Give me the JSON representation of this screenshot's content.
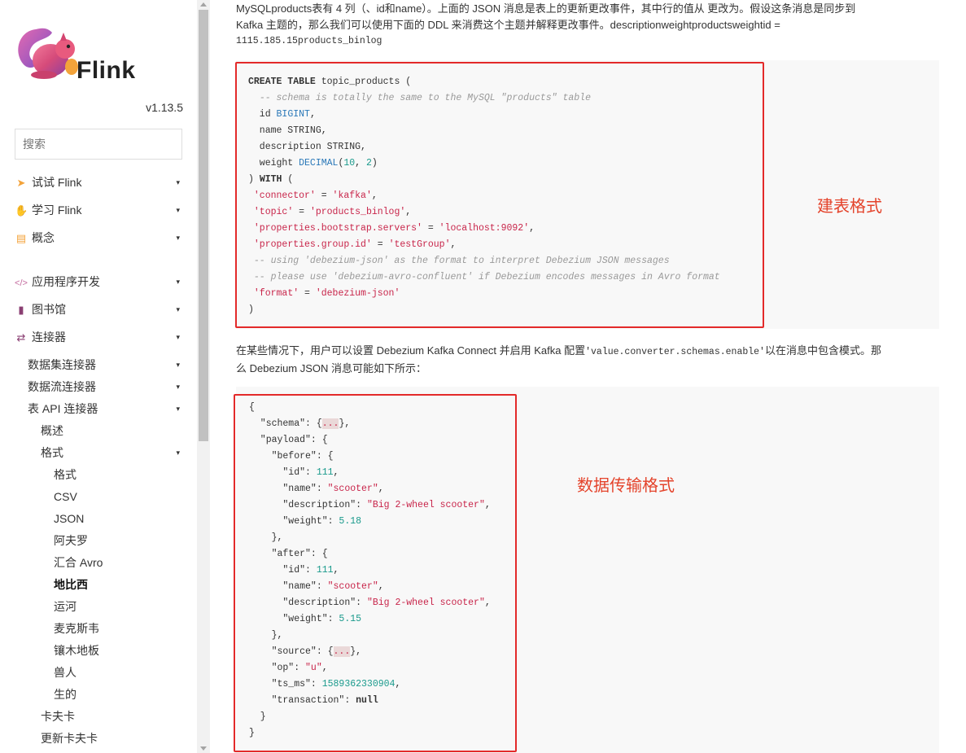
{
  "sidebar": {
    "logo_text": "Flink",
    "version": "v1.13.5",
    "search_placeholder": "搜索",
    "nav": [
      {
        "label": "试试 Flink",
        "icon": "rocket-icon"
      },
      {
        "label": "学习 Flink",
        "icon": "hand-icon"
      },
      {
        "label": "概念",
        "icon": "book-open-icon"
      },
      {
        "label": "应用程序开发",
        "icon": "code-icon"
      },
      {
        "label": "图书馆",
        "icon": "book-icon"
      },
      {
        "label": "连接器",
        "icon": "shuffle-icon"
      }
    ],
    "connectors": {
      "dataset": "数据集连接器",
      "datastream": "数据流连接器",
      "table_api": "表 API 连接器",
      "overview": "概述",
      "formats": "格式",
      "formats_items": [
        "格式",
        "CSV",
        "JSON",
        "阿夫罗",
        "汇合 Avro",
        "地比西",
        "运河",
        "麦克斯韦",
        "镶木地板",
        "兽人",
        "生的"
      ],
      "kafka": "卡夫卡",
      "upsert_kafka": "更新卡夫卡"
    },
    "caret": "▾"
  },
  "content": {
    "intro_line1": "MySQLproducts表有 4 列（、id和name）。上面的 JSON 消息是表上的更新更改事件，其中行的值从 更改为。假设这条消息是同步到",
    "intro_line2": "Kafka 主题的，那么我们可以使用下面的 DDL 来消费这个主题并解释更改事件。descriptionweightproductsweightid =",
    "intro_line3": "1115.185.15products_binlog",
    "para2_line1_a": "在某些情况下，用户可以设置 Debezium Kafka Connect 并启用 Kafka 配置",
    "para2_line1_code": "'value.converter.schemas.enable'",
    "para2_line1_b": "以在消息中包含模式。那",
    "para2_line2": "么 Debezium JSON 消息可能如下所示：",
    "label_ddl": "建表格式",
    "label_json": "数据传输格式"
  }
}
